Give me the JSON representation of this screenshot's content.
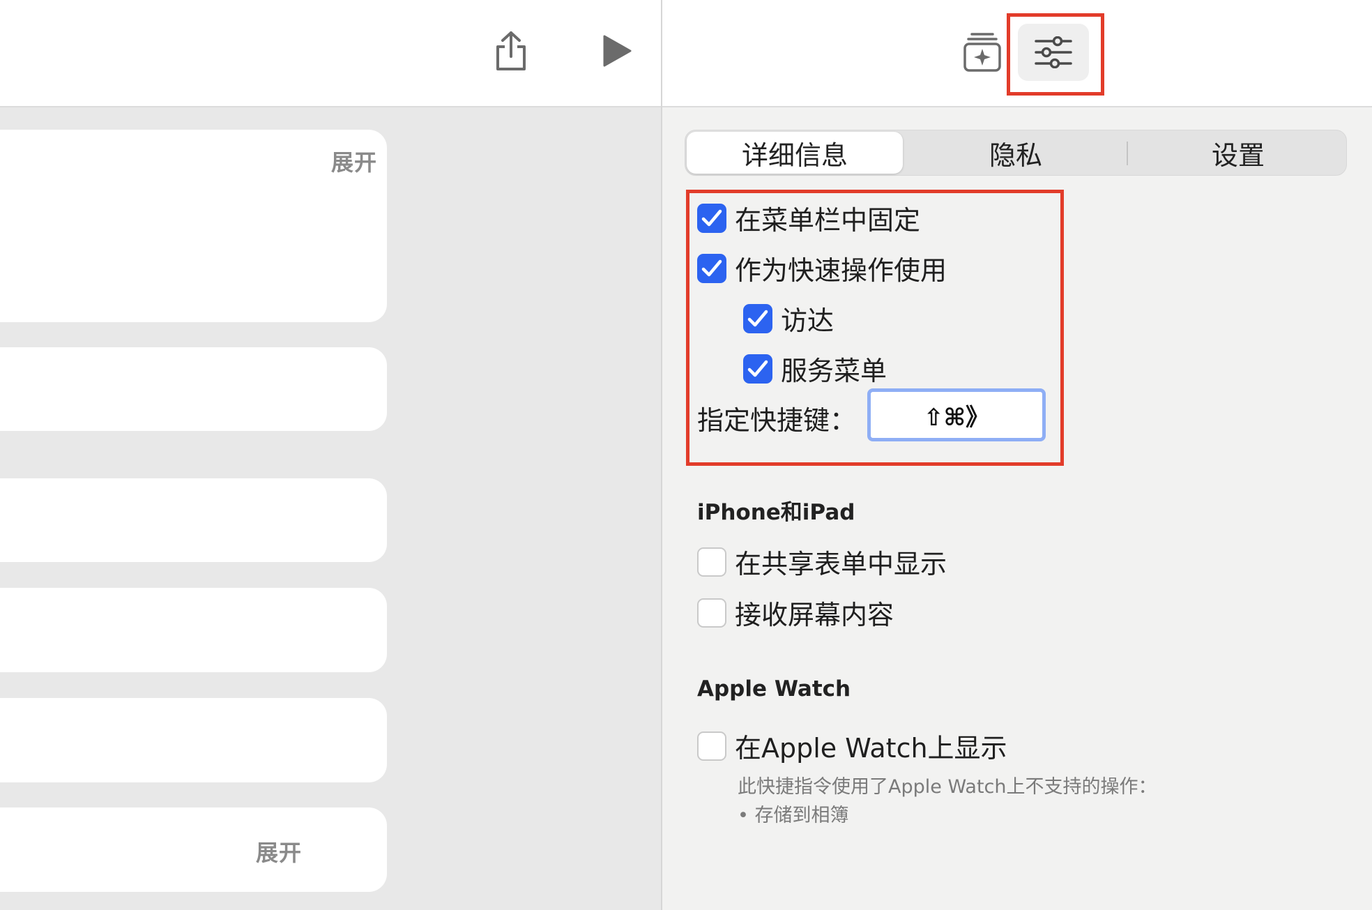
{
  "editor": {
    "cards": [
      {
        "expand_label": "展开"
      },
      {},
      {},
      {},
      {},
      {
        "expand_label": "展开"
      }
    ]
  },
  "inspector": {
    "tabs": [
      {
        "label": "详细信息",
        "selected": true
      },
      {
        "label": "隐私",
        "selected": false
      },
      {
        "label": "设置",
        "selected": false
      }
    ],
    "options": {
      "pin_menu_bar": {
        "label": "在菜单栏中固定",
        "checked": true
      },
      "quick_action": {
        "label": "作为快速操作使用",
        "checked": true
      },
      "finder": {
        "label": "访达",
        "checked": true
      },
      "services_menu": {
        "label": "服务菜单",
        "checked": true
      },
      "shortcut_label": "指定快捷键：",
      "shortcut_value": "⇧⌘》"
    },
    "iphone_ipad": {
      "title": "iPhone和iPad",
      "show_in_share_sheet": {
        "label": "在共享表单中显示",
        "checked": false
      },
      "receive_screen": {
        "label": "接收屏幕内容",
        "checked": false
      }
    },
    "apple_watch": {
      "title": "Apple Watch",
      "show_on_watch": {
        "label": "在Apple Watch上显示",
        "checked": false
      },
      "note_line1": "此快捷指令使用了Apple Watch上不支持的操作：",
      "note_line2": "• 存储到相簿"
    }
  },
  "colors": {
    "accent": "#2c63f0",
    "highlight": "#e23c2a"
  },
  "icons": {
    "share": "share-icon",
    "play": "play-icon",
    "gallery": "shortcut-gallery-icon",
    "settings": "sliders-icon",
    "checkmark": "checkmark-icon"
  }
}
